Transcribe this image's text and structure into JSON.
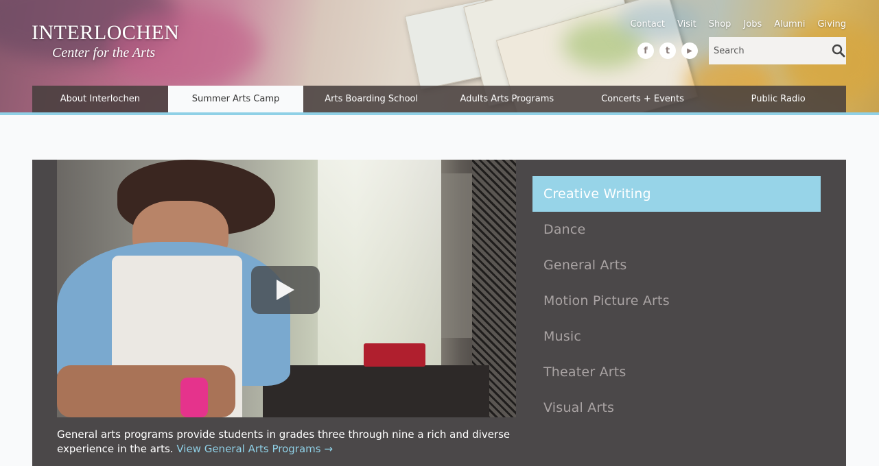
{
  "logo": {
    "name": "INTERLOCHEN",
    "subtitle": "Center for the Arts"
  },
  "utility_links": [
    "Contact",
    "Visit",
    "Shop",
    "Jobs",
    "Alumni",
    "Giving"
  ],
  "social": [
    {
      "icon": "facebook-icon",
      "glyph": "f"
    },
    {
      "icon": "twitter-icon",
      "glyph": "t"
    },
    {
      "icon": "youtube-icon",
      "glyph": "▶"
    }
  ],
  "search": {
    "placeholder": "Search"
  },
  "nav": [
    {
      "label": "About Interlochen",
      "active": false
    },
    {
      "label": "Summer Arts Camp",
      "active": true
    },
    {
      "label": "Arts Boarding School",
      "active": false
    },
    {
      "label": "Adults Arts Programs",
      "active": false
    },
    {
      "label": "Concerts + Events",
      "active": false
    },
    {
      "label": "Public Radio",
      "active": false
    }
  ],
  "video": {
    "play_icon": "play-icon"
  },
  "caption": {
    "text": "General arts programs provide students in grades three through nine a rich and diverse experience in the arts.",
    "link_text": "View General Arts Programs →"
  },
  "programs": [
    {
      "label": "Creative Writing",
      "active": true
    },
    {
      "label": "Dance",
      "active": false
    },
    {
      "label": "General Arts",
      "active": false
    },
    {
      "label": "Motion Picture Arts",
      "active": false
    },
    {
      "label": "Music",
      "active": false
    },
    {
      "label": "Theater Arts",
      "active": false
    },
    {
      "label": "Visual Arts",
      "active": false
    }
  ],
  "colors": {
    "accent": "#97d4e8",
    "nav_bg": "#4a4341",
    "panel_bg": "#4b4849",
    "link": "#8fd0e6"
  }
}
